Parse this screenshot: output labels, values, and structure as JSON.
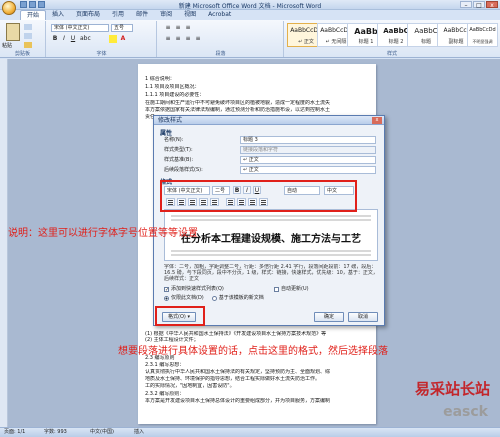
{
  "window": {
    "title": "新建 Microsoft Office Word 文档 - Microsoft Word",
    "controls": [
      "–",
      "□",
      "x"
    ]
  },
  "tabs": [
    "开始",
    "插入",
    "页面布局",
    "引用",
    "邮件",
    "审阅",
    "视图",
    "Acrobat"
  ],
  "ribbon": {
    "paste_label": "粘贴",
    "clipboard_label": "剪贴板",
    "font_name": "宋体 (中文正文)",
    "font_size": "五号",
    "font_group_label": "字体",
    "para_group_label": "段落",
    "styles_group_label": "样式",
    "styles": [
      {
        "sample": "AaBbCcDd",
        "name": "↵ 正文"
      },
      {
        "sample": "AaBbCcDd",
        "name": "↵ 无间隔"
      },
      {
        "sample": "AaBb",
        "name": "标题 1"
      },
      {
        "sample": "AaBbC",
        "name": "标题 2"
      },
      {
        "sample": "AaBbC",
        "name": "标题"
      },
      {
        "sample": "AaBbCcI",
        "name": "副标题"
      },
      {
        "sample": "AaBbCcDd",
        "name": "不明显强调"
      }
    ]
  },
  "document": {
    "lines": [
      "1 综合说明：",
      "1.1 项目及项目区概况：",
      "1.1.1 项目建设的必要性：",
      "在施工期间和生产运行中不可避免破坏项目区的植被地貌，造成一定程度的水土流失",
      "本方案依据国家有关法律法规编制，通过预测分析和防治措施布设，以达到控制水土",
      "责任"
    ],
    "lines_bottom": [
      "(1) 根据《中华人民共和国水土保持法》《开发建设项目水土保持方案技术规范》等",
      "(2) 主体工程设计文件；",
      "2.3 编写原则",
      "2.3.1 编写思想：",
      "认真贯彻执行中华人民共和国水土保持法的有关规定，坚持预防为主、全面规划、综",
      "地质及水土保持、环境保护的指导思想，结合工程实际做好水土流失防治工作。",
      "工的实际情况，\"因地制宜，因害设防\"。",
      "2.3.2 编写原则：",
      "本方案是开发建设项目水土保持总体设计的重要组成部分，并为项目服务，方案编制"
    ]
  },
  "dialog": {
    "title": "修改样式",
    "properties_header": "属性",
    "fields": [
      {
        "label": "名称(N):",
        "value": "标题 3"
      },
      {
        "label": "样式类型(T):",
        "value": "链接段落和字符"
      },
      {
        "label": "样式基准(B):",
        "value": "↵ 正文"
      },
      {
        "label": "后续段落样式(S):",
        "value": "↵ 正文"
      }
    ],
    "format_header": "格式",
    "font": "宋体 (中文正文)",
    "size": "二号",
    "bold": "B",
    "italic": "I",
    "underline": "U",
    "color": "自动",
    "script": "中文",
    "preview_text": "在分析本工程建设规模、施工方法与工艺",
    "description": "字体：二号，加粗，字距调整二号，行距：多倍行距 2.41 字行，段落间距段前：17 磅，段后：16.5 磅，与下段同页，段中不分页，1 级，样式：链接，快速样式，优先级：10，基于：正文，后续样式：正文",
    "add_to_quick": "添加到快速样式列表(Q)",
    "auto_update": "自动更新(U)",
    "only_this_doc": "仅限此文档(D)",
    "new_docs_template": "基于该模板的新文档",
    "format_btn": "格式(O) ▾",
    "ok": "确定",
    "cancel": "取消"
  },
  "annotations": {
    "note1": "说明：这里可以进行字体字号位置等等设置",
    "note2": "想要段落进行具体设置的话，点击这里的格式，然后选择段落"
  },
  "status": {
    "page": "页面: 1/1",
    "words": "字数: 993",
    "lang": "中文(中国)",
    "mode": "插入"
  },
  "watermark": {
    "cn": "易采站长站",
    "en": "easck"
  },
  "colors": {
    "annotation": "#e0201a",
    "watermark_red": "#c3262b"
  }
}
